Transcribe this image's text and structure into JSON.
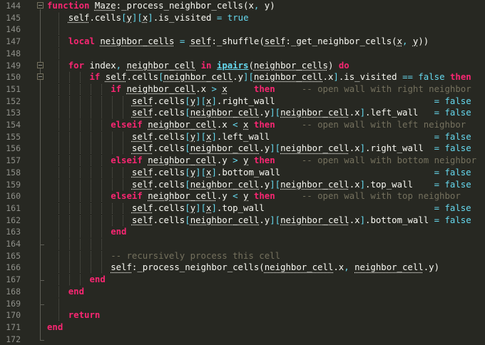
{
  "editor": {
    "theme_colors": {
      "background": "#272822",
      "keyword": "#f92672",
      "constant": "#66d9ef",
      "comment": "#75715e",
      "text": "#f8f8f2",
      "line_number": "#8f908a"
    },
    "fold_markers_at": [
      "144",
      "149",
      "150"
    ],
    "lines": [
      {
        "n": "144",
        "text": "function Maze:_process_neighbor_cells(x, y)"
      },
      {
        "n": "145",
        "text": "    self.cells[y][x].is_visited = true"
      },
      {
        "n": "146",
        "text": ""
      },
      {
        "n": "147",
        "text": "    local neighbor_cells = self:_shuffle(self:_get_neighbor_cells(x, y))"
      },
      {
        "n": "148",
        "text": ""
      },
      {
        "n": "149",
        "text": "    for index, neighbor_cell in ipairs(neighbor_cells) do"
      },
      {
        "n": "150",
        "text": "        if self.cells[neighbor_cell.y][neighbor_cell.x].is_visited == false then"
      },
      {
        "n": "151",
        "text": "            if neighbor_cell.x > x     then     -- open wall with right neighbor"
      },
      {
        "n": "152",
        "text": "                self.cells[y][x].right_wall                              = false"
      },
      {
        "n": "153",
        "text": "                self.cells[neighbor_cell.y][neighbor_cell.x].left_wall   = false"
      },
      {
        "n": "154",
        "text": "            elseif neighbor_cell.x < x then     -- open wall with left neighbor"
      },
      {
        "n": "155",
        "text": "                self.cells[y][x].left_wall                               = false"
      },
      {
        "n": "156",
        "text": "                self.cells[neighbor_cell.y][neighbor_cell.x].right_wall  = false"
      },
      {
        "n": "157",
        "text": "            elseif neighbor_cell.y > y then     -- open wall with bottom neighbor"
      },
      {
        "n": "158",
        "text": "                self.cells[y][x].bottom_wall                             = false"
      },
      {
        "n": "159",
        "text": "                self.cells[neighbor_cell.y][neighbor_cell.x].top_wall    = false"
      },
      {
        "n": "160",
        "text": "            elseif neighbor_cell.y < y then     -- open wall with top neighbor"
      },
      {
        "n": "161",
        "text": "                self.cells[y][x].top_wall                                = false"
      },
      {
        "n": "162",
        "text": "                self.cells[neighbor_cell.y][neighbor_cell.x].bottom_wall = false"
      },
      {
        "n": "163",
        "text": "            end"
      },
      {
        "n": "164",
        "text": ""
      },
      {
        "n": "165",
        "text": "            -- recursively process this cell"
      },
      {
        "n": "166",
        "text": "            self:_process_neighbor_cells(neighbor_cell.x, neighbor_cell.y)"
      },
      {
        "n": "167",
        "text": "        end"
      },
      {
        "n": "168",
        "text": "    end"
      },
      {
        "n": "169",
        "text": ""
      },
      {
        "n": "170",
        "text": "    return"
      },
      {
        "n": "171",
        "text": "end"
      },
      {
        "n": "172",
        "text": ""
      }
    ]
  }
}
